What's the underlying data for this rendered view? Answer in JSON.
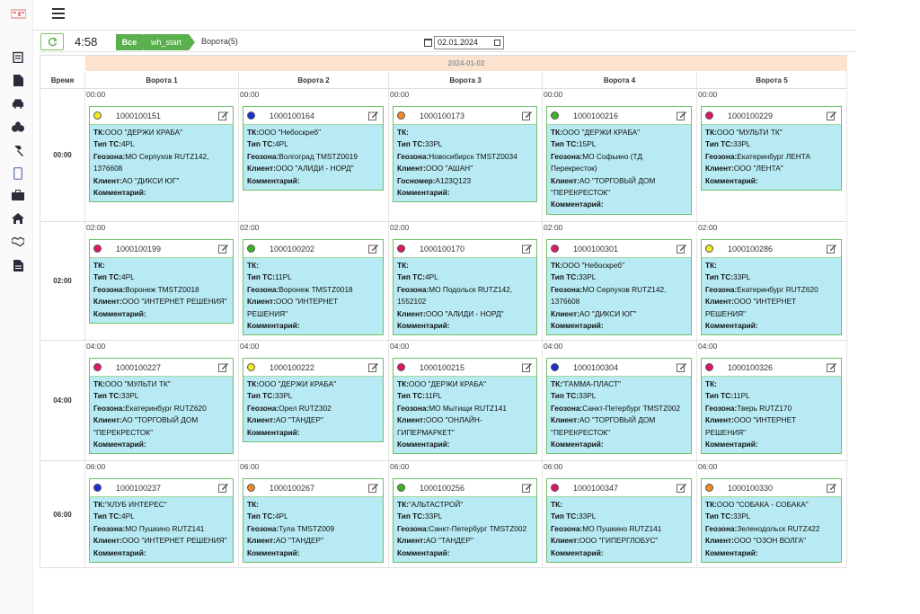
{
  "colors": {
    "accent": "#5ab04c",
    "card_bg": "#b7eaf2",
    "card_border": "#6fc06a",
    "date_band": "#fbe3cf"
  },
  "sidebar": {
    "icons": [
      "clipboard-icon",
      "document-icon",
      "car-icon",
      "stats-icon",
      "hammer-icon",
      "phone-icon",
      "briefcase-icon",
      "home-icon",
      "handshake-icon",
      "file-text-icon"
    ]
  },
  "toolbar": {
    "clock": "4:58",
    "breadcrumb_all": "Все",
    "breadcrumb_warehouse": "wh_start",
    "breadcrumb_gates": "Ворота(5)",
    "date_value": "02.01.2024"
  },
  "grid": {
    "date_header": "2024-01-02",
    "time_header": "Время",
    "columns": [
      "Ворота 1",
      "Ворота 2",
      "Ворота 3",
      "Ворота 4",
      "Ворота 5"
    ],
    "labels": {
      "tk": "ТК:",
      "type": "Тип ТС:",
      "geo": "Геозона:",
      "client": "Клиент:",
      "gosnomer": "Госномер:",
      "comment": "Комментарий:"
    },
    "rows": [
      {
        "time": "00:00",
        "cells": [
          {
            "slot": "00:00",
            "id": "1000100151",
            "dot": "#f1e91a",
            "tk": "ООО \"ДЕРЖИ КРАБА\"",
            "type": "4PL",
            "geo": "МО Серпухов RUTZ142, 1376608",
            "client": "АО \"ДИКСИ ЮГ\""
          },
          {
            "slot": "00:00",
            "id": "1000100164",
            "dot": "#1a2fd6",
            "tk": "ООО \"Небоскреб\"",
            "type": "4PL",
            "geo": "Волгоград TMSTZ0019",
            "client": "ООО \"АЛИДИ - НОРД\""
          },
          {
            "slot": "00:00",
            "id": "1000100173",
            "dot": "#f08a24",
            "tk": "",
            "type": "33PL",
            "geo": "Новосибирск TMSTZ0034",
            "client": "ООО \"АШАН\"",
            "gosnomer": "А123Q123"
          },
          {
            "slot": "00:00",
            "id": "1000100216",
            "dot": "#3cb521",
            "tk": "ООО \"ДЕРЖИ КРАБА\"",
            "type": "15PL",
            "geo": "МО Софьино (ТД Перекресток)",
            "client": "АО \"ТОРГОВЫЙ ДОМ \"ПЕРЕКРЕСТОК\""
          },
          {
            "slot": "00:00",
            "id": "1000100229",
            "dot": "#e0156a",
            "tk": "ООО \"МУЛЬТИ ТК\"",
            "type": "33PL",
            "geo": "Екатеринбург ЛЕНТА",
            "client": "ООО \"ЛЕНТА\""
          }
        ]
      },
      {
        "time": "02:00",
        "cells": [
          {
            "slot": "02:00",
            "id": "1000100199",
            "dot": "#e0156a",
            "tk": "",
            "type": "4PL",
            "geo": "Воронеж TMSTZ0018",
            "client": "ООО \"ИНТЕРНЕТ РЕШЕНИЯ\""
          },
          {
            "slot": "02:00",
            "id": "1000100202",
            "dot": "#3cb521",
            "tk": "",
            "type": "11PL",
            "geo": "Воронеж TMSTZ0018",
            "client": "ООО \"ИНТЕРНЕТ РЕШЕНИЯ\""
          },
          {
            "slot": "02:00",
            "id": "1000100170",
            "dot": "#e0156a",
            "tk": "",
            "type": "4PL",
            "geo": "МО Подольск RUTZ142, 1552102",
            "client": "ООО \"АЛИДИ - НОРД\""
          },
          {
            "slot": "02:00",
            "id": "1000100301",
            "dot": "#e0156a",
            "tk": "ООО \"Небоскреб\"",
            "type": "33PL",
            "geo": "МО Серпухов RUTZ142, 1376608",
            "client": "АО \"ДИКСИ ЮГ\""
          },
          {
            "slot": "02:00",
            "id": "1000100286",
            "dot": "#f1e91a",
            "tk": "",
            "type": "33PL",
            "geo": "Екатеринбург RUTZ620",
            "client": "ООО \"ИНТЕРНЕТ РЕШЕНИЯ\""
          }
        ]
      },
      {
        "time": "04:00",
        "cells": [
          {
            "slot": "04:00",
            "id": "1000100227",
            "dot": "#e0156a",
            "tk": "ООО \"МУЛЬТИ ТК\"",
            "type": "33PL",
            "geo": "Екатеринбург RUTZ620",
            "client": "АО \"ТОРГОВЫЙ ДОМ \"ПЕРЕКРЕСТОК\""
          },
          {
            "slot": "04:00",
            "id": "1000100222",
            "dot": "#f1e91a",
            "tk": "ООО \"ДЕРЖИ КРАБА\"",
            "type": "33PL",
            "geo": "Орел RUTZ302",
            "client": "АО \"ТАНДЕР\""
          },
          {
            "slot": "04:00",
            "id": "1000100215",
            "dot": "#e0156a",
            "tk": "ООО \"ДЕРЖИ КРАБА\"",
            "type": "11PL",
            "geo": "МО Мытищи RUTZ141",
            "client": "ООО \"ОНЛАЙН-ГИПЕРМАРКЕТ\""
          },
          {
            "slot": "04:00",
            "id": "1000100304",
            "dot": "#1a2fd6",
            "tk": "\"ГАММА-ПЛАСТ\"",
            "type": "33PL",
            "geo": "Санкт-Петербург TMSTZ002",
            "client": "АО \"ТОРГОВЫЙ ДОМ \"ПЕРЕКРЕСТОК\""
          },
          {
            "slot": "04:00",
            "id": "1000100326",
            "dot": "#e0156a",
            "tk": "",
            "type": "11PL",
            "geo": "Тверь RUTZ170",
            "client": "ООО \"ИНТЕРНЕТ РЕШЕНИЯ\""
          }
        ]
      },
      {
        "time": "06:00",
        "cells": [
          {
            "slot": "06:00",
            "id": "1000100237",
            "dot": "#1a2fd6",
            "tk": "\"КЛУБ ИНТЕРЕС\"",
            "type": "4PL",
            "geo": "МО Пушкино RUTZ141",
            "client": "ООО \"ИНТЕРНЕТ РЕШЕНИЯ\""
          },
          {
            "slot": "06:00",
            "id": "1000100267",
            "dot": "#f08a24",
            "tk": "",
            "type": "4PL",
            "geo": "Тула TMSTZ009",
            "client": "АО \"ТАНДЕР\""
          },
          {
            "slot": "06:00",
            "id": "1000100256",
            "dot": "#3cb521",
            "tk": "\"АЛЬТАСТРОЙ\"",
            "type": "33PL",
            "geo": "Санкт-Петербург TMSTZ002",
            "client": "АО \"ТАНДЕР\""
          },
          {
            "slot": "06:00",
            "id": "1000100347",
            "dot": "#e0156a",
            "tk": "",
            "type": "33PL",
            "geo": "МО Пушкино RUTZ141",
            "client": "ООО \"ГИПЕРГЛОБУС\""
          },
          {
            "slot": "06:00",
            "id": "1000100330",
            "dot": "#f08a24",
            "tk": "ООО \"СОБАКА - СОБАКА\"",
            "type": "33PL",
            "geo": "Зеленодольск RUTZ422",
            "client": "ООО \"ОЗОН ВОЛГА\""
          }
        ]
      }
    ]
  }
}
